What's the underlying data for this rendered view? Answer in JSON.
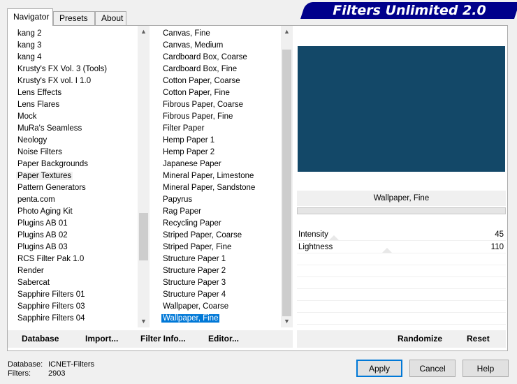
{
  "title": "Filters Unlimited 2.0",
  "tabs": [
    {
      "label": "Navigator"
    },
    {
      "label": "Presets"
    },
    {
      "label": "About"
    }
  ],
  "categories": [
    "kang 2",
    "kang 3",
    "kang 4",
    "Krusty's FX Vol. 3 (Tools)",
    "Krusty's FX vol. I 1.0",
    "Lens Effects",
    "Lens Flares",
    "Mock",
    "MuRa's Seamless",
    "Neology",
    "Noise Filters",
    "Paper Backgrounds",
    "Paper Textures",
    "Pattern Generators",
    "penta.com",
    "Photo Aging Kit",
    "Plugins AB 01",
    "Plugins AB 02",
    "Plugins AB 03",
    "RCS Filter Pak 1.0",
    "Render",
    "Sabercat",
    "Sapphire Filters 01",
    "Sapphire Filters 03",
    "Sapphire Filters 04"
  ],
  "selected_category": "Paper Textures",
  "filters": [
    "Canvas, Fine",
    "Canvas, Medium",
    "Cardboard Box, Coarse",
    "Cardboard Box, Fine",
    "Cotton Paper, Coarse",
    "Cotton Paper, Fine",
    "Fibrous Paper, Coarse",
    "Fibrous Paper, Fine",
    "Filter Paper",
    "Hemp Paper 1",
    "Hemp Paper 2",
    "Japanese Paper",
    "Mineral Paper, Limestone",
    "Mineral Paper, Sandstone",
    "Papyrus",
    "Rag Paper",
    "Recycling Paper",
    "Striped Paper, Coarse",
    "Striped Paper, Fine",
    "Structure Paper 1",
    "Structure Paper 2",
    "Structure Paper 3",
    "Structure Paper 4",
    "Wallpaper, Coarse",
    "Wallpaper, Fine"
  ],
  "selected_filter": "Wallpaper, Fine",
  "preview_color": "#134868",
  "filter_name": "Wallpaper, Fine",
  "controls": [
    {
      "label": "Intensity",
      "value": "45",
      "level": 0.176
    },
    {
      "label": "Lightness",
      "value": "110",
      "level": 0.431
    }
  ],
  "toolbar": {
    "database": "Database",
    "import": "Import...",
    "filter_info": "Filter Info...",
    "editor": "Editor...",
    "randomize": "Randomize",
    "reset": "Reset"
  },
  "status": {
    "database_label": "Database:",
    "database_value": "ICNET-Filters",
    "filters_label": "Filters:",
    "filters_value": "2903"
  },
  "buttons": {
    "apply": "Apply",
    "cancel": "Cancel",
    "help": "Help"
  }
}
